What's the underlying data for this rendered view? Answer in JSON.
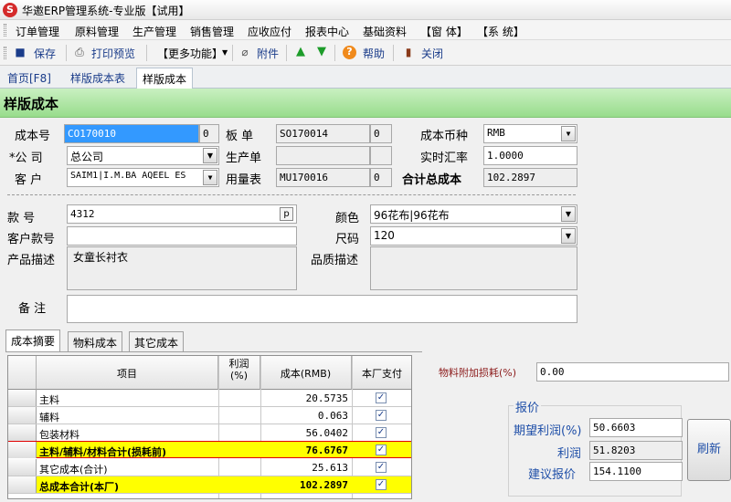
{
  "window": {
    "title": "华邀ERP管理系统-专业版【试用】",
    "logo_glyph": "S"
  },
  "menu": [
    "订单管理",
    "原料管理",
    "生产管理",
    "销售管理",
    "应收应付",
    "报表中心",
    "基础资料",
    "【窗 体】",
    "【系 统】"
  ],
  "toolbar": {
    "save": "保存",
    "print_preview": "打印预览",
    "more": "【更多功能】",
    "attachment": "附件",
    "help": "帮助",
    "close": "关闭"
  },
  "tabs": [
    "首页[F8]",
    "样版成本表",
    "样版成本"
  ],
  "page_title": "样版成本",
  "form": {
    "cost_no_label": "成本号",
    "cost_no": "CO170010",
    "cost_no_count": "0",
    "sample_label": "板 单",
    "sample": "SO170014",
    "sample_count": "0",
    "currency_label": "成本币种",
    "currency": "RMB",
    "company_label": "*公 司",
    "company": "总公司",
    "production_label": "生产单",
    "production": "",
    "rate_label": "实时汇率",
    "rate": "1.0000",
    "customer_label": "客 户",
    "customer": "SAIM1|I.M.BA AQEEL ES",
    "usage_label": "用量表",
    "usage": "MU170016",
    "usage_count": "0",
    "total_label": "合计总成本",
    "total": "102.2897",
    "style_label": "款 号",
    "style": "4312",
    "style_btn": "p",
    "color_label": "颜色",
    "color": "96花布|96花布",
    "customer_style_label": "客户款号",
    "customer_style": "",
    "size_label": "尺码",
    "size": "120",
    "desc_label": "产品描述",
    "desc": "女童长衬衣",
    "quality_label": "品质描述",
    "quality": "",
    "remark_label": "备 注",
    "remark": ""
  },
  "inner_tabs": [
    "成本摘要",
    "物料成本",
    "其它成本"
  ],
  "grid": {
    "headers": [
      "项目",
      "利润\n(%)",
      "成本(RMB)",
      "本厂支付"
    ],
    "rows": [
      {
        "name": "主料",
        "value": "20.5735"
      },
      {
        "name": "辅料",
        "value": "0.063"
      },
      {
        "name": "包装材料",
        "value": "56.0402"
      },
      {
        "name": "主料/辅料/材料合计(损耗前)",
        "value": "76.6767"
      },
      {
        "name": "其它成本(合计)",
        "value": "25.613"
      },
      {
        "name": "总成本合计(本厂)",
        "value": "102.2897"
      }
    ]
  },
  "right": {
    "loss_label": "物料附加损耗(%)",
    "loss": "0.00",
    "quote_title": "报价",
    "expected_profit_label": "期望利润(%)",
    "expected_profit": "50.6603",
    "profit_label": "利润",
    "profit": "51.8203",
    "suggest_label": "建议报价",
    "suggest": "154.1100",
    "refresh": "刷新"
  }
}
